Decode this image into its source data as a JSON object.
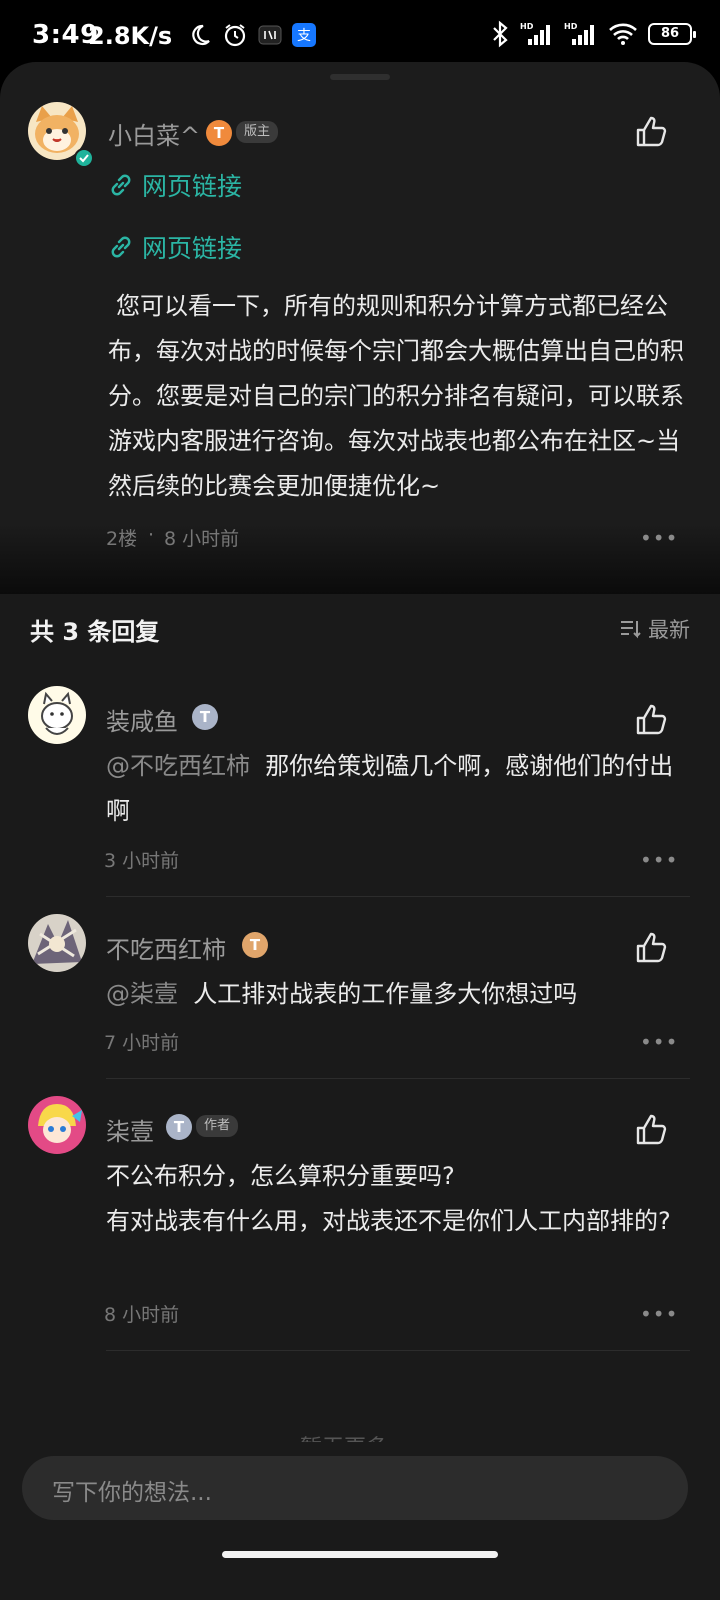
{
  "status_bar": {
    "time": "3:49",
    "network_speed": "2.8K/s",
    "battery": "86",
    "icons": [
      "moon-icon",
      "alarm-icon",
      "nfc-icon",
      "alipay-icon",
      "bluetooth-icon",
      "signal-hd-icon",
      "signal-hd-icon",
      "wifi-icon",
      "battery-icon"
    ]
  },
  "post": {
    "author": "小白菜^",
    "level": "T",
    "role_badge": "版主",
    "links": [
      "网页链接",
      "网页链接"
    ],
    "body": "您可以看一下，所有的规则和积分计算方式都已经公布，每次对战的时候每个宗门都会大概估算出自己的积分。您要是对自己的宗门的积分排名有疑问，可以联系游戏内客服进行咨询。每次对战表也都公布在社区~当然后续的比赛会更加便捷优化~",
    "floor": "2楼",
    "separator": "·",
    "time": "8 小时前",
    "more": "•••"
  },
  "replies": {
    "title": "共 3 条回复",
    "sort_label": "最新",
    "items": [
      {
        "author": "装咸鱼",
        "level": "T",
        "mention": "@不吃西红柿",
        "text": "那你给策划磕几个啊，感谢他们的付出啊",
        "time": "3 小时前",
        "more": "•••"
      },
      {
        "author": "不吃西红柿",
        "level": "T",
        "mention": "@柒壹",
        "text": "人工排对战表的工作量多大你想过吗",
        "time": "7 小时前",
        "more": "•••"
      },
      {
        "author": "柒壹",
        "level": "T",
        "role_badge": "作者",
        "text_line1": "不公布积分，怎么算积分重要吗?",
        "text_line2": "有对战表有什么用，对战表还不是你们人工内部排的?",
        "time": "8 小时前",
        "more": "•••"
      }
    ],
    "load_more": "暂无更多"
  },
  "input": {
    "placeholder": "写下你的想法..."
  },
  "colors": {
    "link": "#2bb5a4",
    "badge_orange": "#f08a3c",
    "badge_silver": "#aab4c8",
    "badge_gold": "#e0a56b"
  }
}
